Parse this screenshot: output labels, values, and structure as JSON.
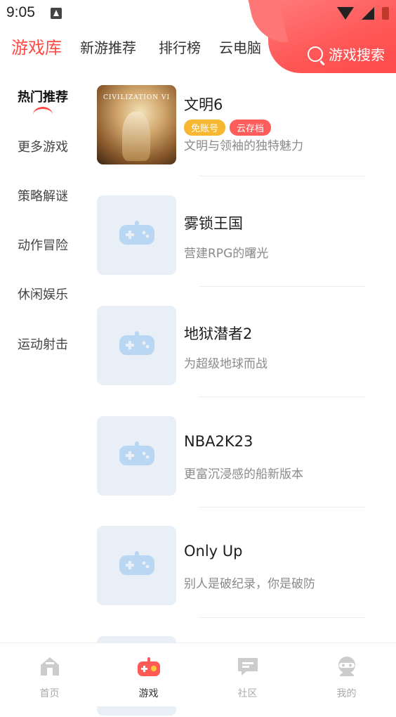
{
  "status_bar": {
    "time": "9:05"
  },
  "header": {
    "tabs": [
      {
        "label": "游戏库",
        "active": true
      },
      {
        "label": "新游推荐"
      },
      {
        "label": "排行榜"
      },
      {
        "label": "云电脑"
      }
    ],
    "search_label": "游戏搜索"
  },
  "sidebar": {
    "items": [
      {
        "label": "热门推荐",
        "active": true
      },
      {
        "label": "更多游戏"
      },
      {
        "label": "策略解谜"
      },
      {
        "label": "动作冒险"
      },
      {
        "label": "休闲娱乐"
      },
      {
        "label": "运动射击"
      }
    ]
  },
  "games": [
    {
      "title": "文明6",
      "desc": "文明与领袖的独特魅力",
      "cover_text": "CIVILIZATION VI",
      "tags": [
        "免账号",
        "云存档"
      ]
    },
    {
      "title": "雾锁王国",
      "desc": "营建RPG的曙光"
    },
    {
      "title": "地狱潜者2",
      "desc": "为超级地球而战"
    },
    {
      "title": "NBA2K23",
      "desc": "更富沉浸感的船新版本"
    },
    {
      "title": "Only Up",
      "desc": "别人是破纪录，你是破防"
    }
  ],
  "bottom_nav": [
    {
      "label": "首页",
      "icon": "home-icon"
    },
    {
      "label": "游戏",
      "icon": "gamepad-icon",
      "active": true
    },
    {
      "label": "社区",
      "icon": "chat-icon"
    },
    {
      "label": "我的",
      "icon": "profile-icon"
    }
  ],
  "colors": {
    "accent": "#ff4a44",
    "tag_yellow": "#f7b731",
    "tag_red": "#ff5c5c",
    "placeholder_bg": "#e8eff7",
    "placeholder_icon": "#b9d6f2"
  }
}
